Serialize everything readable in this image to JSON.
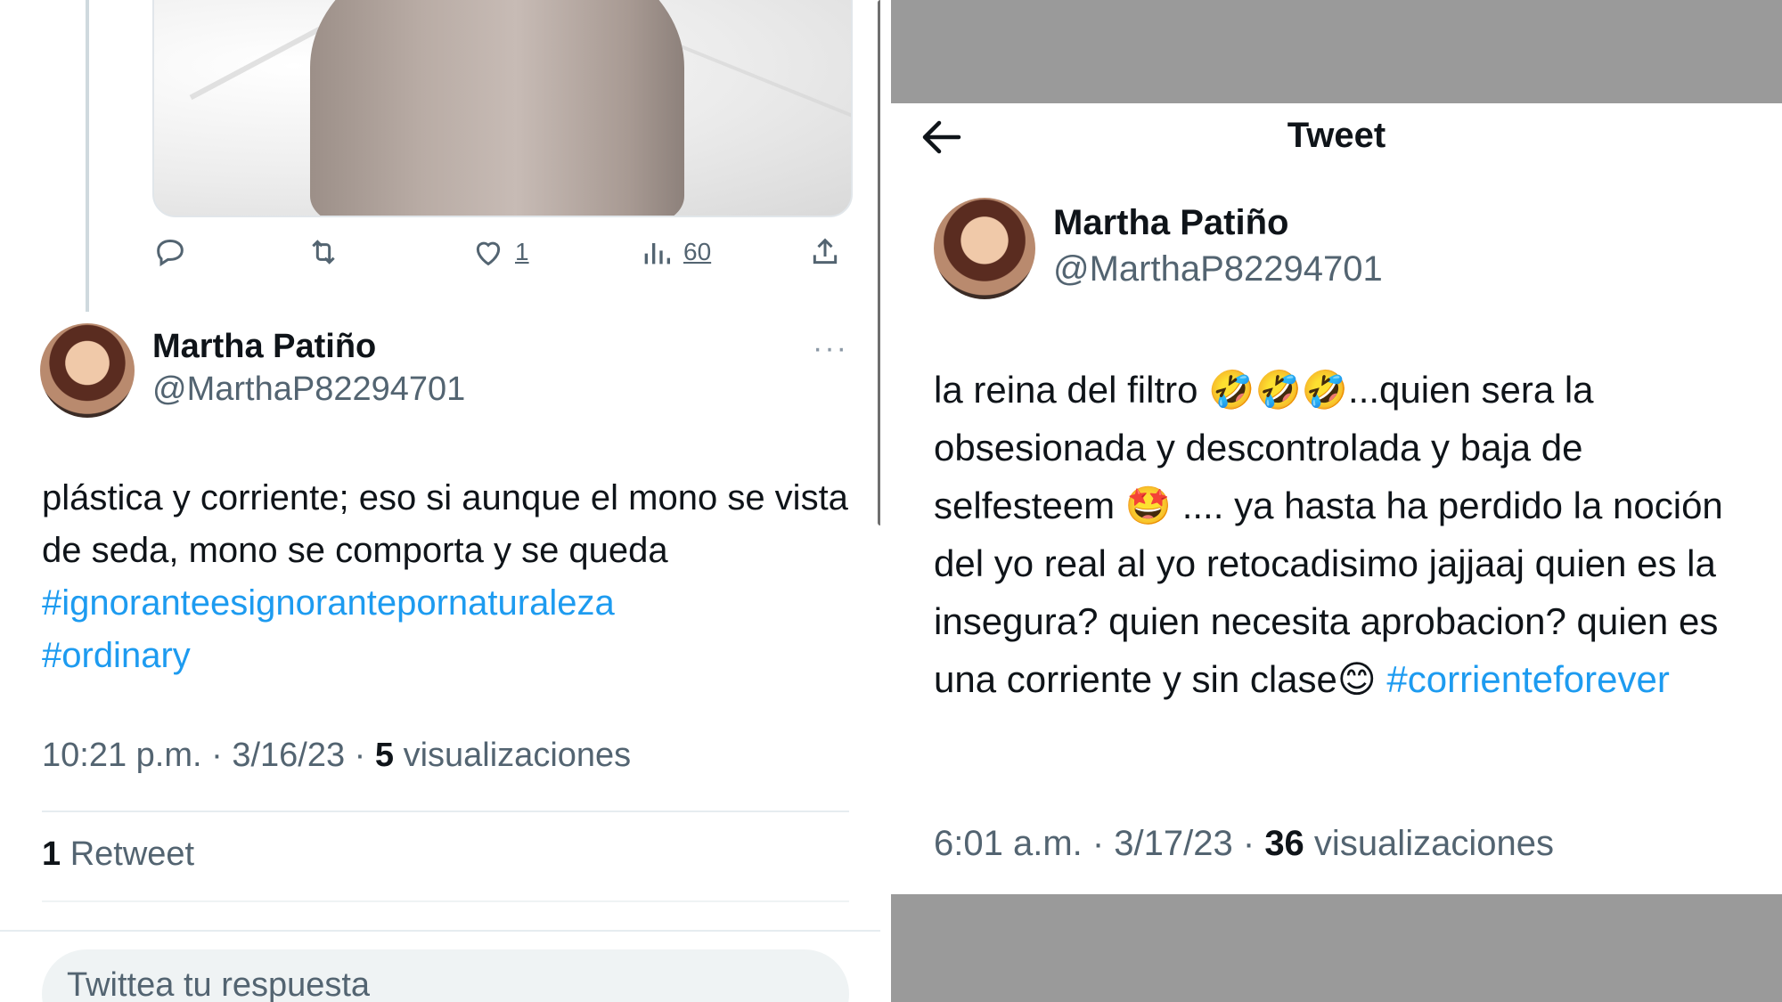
{
  "left": {
    "actions": {
      "reply_count": "",
      "retweet_count": "",
      "like_count": "1",
      "views_count": "60"
    },
    "tweet": {
      "name": "Martha Patiño",
      "handle": "@MarthaP82294701",
      "more_label": "···",
      "text": "plástica y corriente; eso si aunque el mono se vista de seda, mono se comporta y se queda",
      "hashtags": [
        "#ignoranteesignorantepornaturaleza",
        "#ordinary"
      ],
      "time": "10:21 p.m. · 3/16/23 · ",
      "views_number": "5",
      "views_label": " visualizaciones",
      "retweets_number": "1",
      "retweets_label": " Retweet"
    },
    "reply_placeholder": "Twittea tu respuesta"
  },
  "right": {
    "header_title": "Tweet",
    "tweet": {
      "name": "Martha Patiño",
      "handle": "@MarthaP82294701",
      "text": "la reina del filtro 🤣🤣🤣...quien sera la obsesionada y descontrolada y baja de selfesteem 🤩 .... ya hasta ha perdido la noción del yo real al yo retocadisimo jajjaaj quien es la insegura? quien necesita aprobacion? quien es una corriente y sin clase😊 ",
      "hashtag": "#corrienteforever",
      "time": "6:01 a.m. · 3/17/23 · ",
      "views_number": "36",
      "views_label": " visualizaciones"
    }
  },
  "colors": {
    "link": "#1d9bf0",
    "secondary_text": "#536471",
    "primary_text": "#0f1419",
    "frame_gray": "#9a9a9a"
  },
  "icons": [
    "reply-icon",
    "retweet-icon",
    "like-icon",
    "views-icon",
    "share-icon",
    "back-arrow-icon",
    "more-icon"
  ]
}
